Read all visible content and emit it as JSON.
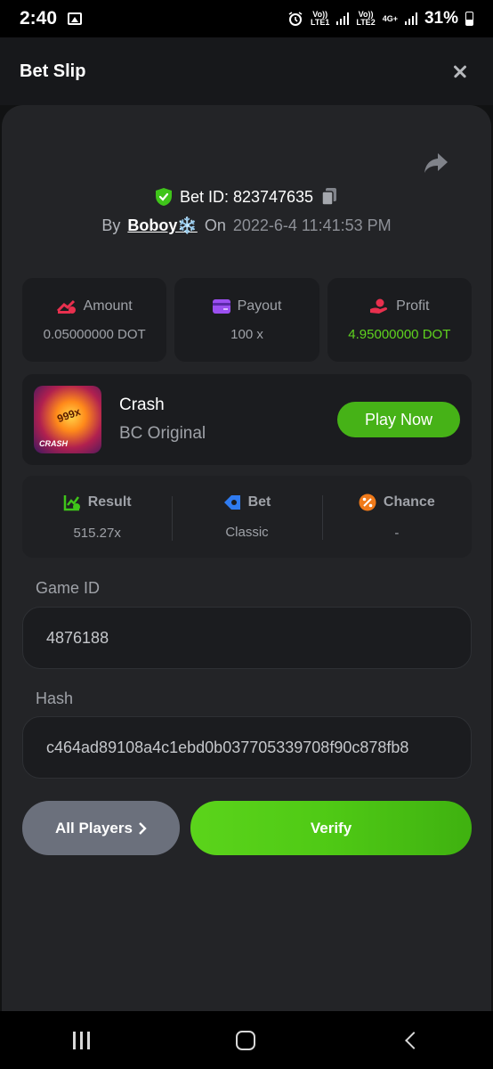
{
  "status_bar": {
    "time": "2:40",
    "sim1": "Vo))\nLTE1",
    "sim2": "Vo))\nLTE2",
    "network": "4G+",
    "battery": "31%"
  },
  "header": {
    "title": "Bet Slip"
  },
  "bet": {
    "id_label": "Bet ID: 823747635",
    "by_label": "By",
    "user": "Boboy❄️",
    "on_label": "On",
    "date": "2022-6-4 11:41:53 PM"
  },
  "stats": {
    "amount_label": "Amount",
    "amount_value": "0.05000000 DOT",
    "payout_label": "Payout",
    "payout_value": "100 x",
    "profit_label": "Profit",
    "profit_value": "4.95000000 DOT"
  },
  "game": {
    "thumb_multiplier": "999x",
    "thumb_label": "CRASH",
    "name": "Crash",
    "provider": "BC Original",
    "play_label": "Play Now"
  },
  "result": {
    "result_label": "Result",
    "result_value": "515.27x",
    "bet_label": "Bet",
    "bet_value": "Classic",
    "chance_label": "Chance",
    "chance_value": "-"
  },
  "fields": {
    "game_id_label": "Game ID",
    "game_id_value": "4876188",
    "hash_label": "Hash",
    "hash_value": "c464ad89108a4c1ebd0b037705339708f90c878fb8"
  },
  "actions": {
    "all_players_label": "All Players",
    "verify_label": "Verify"
  },
  "colors": {
    "accent_green": "#46b217",
    "profit_green": "#5fd31f",
    "background": "#232427"
  }
}
